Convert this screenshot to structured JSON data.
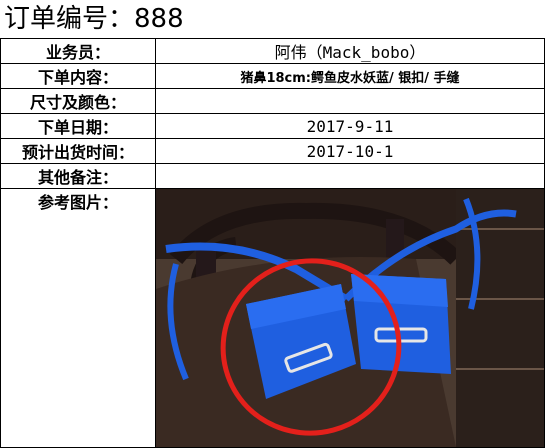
{
  "order": {
    "title_prefix": "订单编号：",
    "number": "888"
  },
  "rows": [
    {
      "label": "业务员：",
      "value": "阿伟（Mack_bobo）"
    },
    {
      "label": "下单内容：",
      "value": "猪鼻18cm:鳄鱼皮水妖蓝/ 银扣/ 手缝"
    },
    {
      "label": "尺寸及颜色：",
      "value": ""
    },
    {
      "label": "下单日期：",
      "value": "2017-9-11"
    },
    {
      "label": "预计出货时间：",
      "value": "2017-10-1"
    },
    {
      "label": "其他备注：",
      "value": ""
    },
    {
      "label": "参考图片：",
      "value": ""
    }
  ],
  "photo": {
    "subject": "two blue crocodile-leather handbags with silver buckles on a dark wooden chair, red circle marking the left bag",
    "colors": {
      "bag": "#1f5fe0",
      "circle": "#e3201b",
      "chair": "#3a2a22"
    }
  }
}
